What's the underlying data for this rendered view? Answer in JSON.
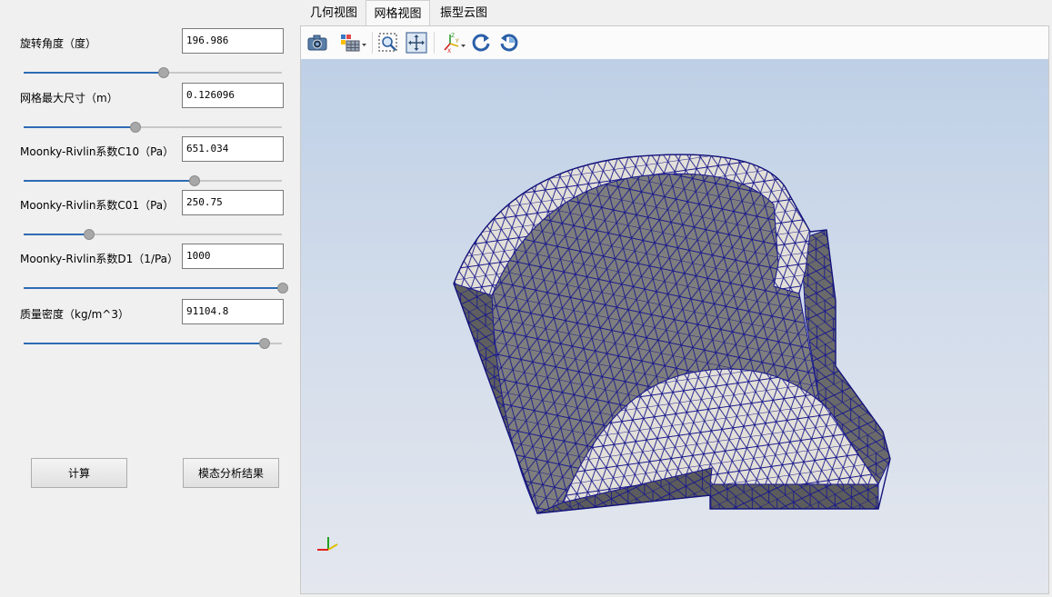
{
  "params": [
    {
      "label": "旋转角度（度）",
      "value": "196.986",
      "slider": 0.54
    },
    {
      "label": "网格最大尺寸（m）",
      "value": "0.126096",
      "slider": 0.43
    },
    {
      "label": "Moonky-Rivlin系数C10（Pa）",
      "value": "651.034",
      "slider": 0.66
    },
    {
      "label": "Moonky-Rivlin系数C01（Pa）",
      "value": "250.75",
      "slider": 0.25
    },
    {
      "label": "Moonky-Rivlin系数D1（1/Pa）",
      "value": "1000",
      "slider": 1.0
    },
    {
      "label": "质量密度（kg/m^3）",
      "value": "91104.8",
      "slider": 0.93
    }
  ],
  "buttons": {
    "compute": "计算",
    "results": "模态分析结果"
  },
  "tabs": [
    "几何视图",
    "网格视图",
    "振型云图"
  ],
  "active_tab": 1,
  "toolbar_icons": [
    "camera-icon",
    "display-mode-icon",
    "zoom-box-icon",
    "fit-view-icon",
    "axes-orientation-icon",
    "rotate-cw-icon",
    "rotate-ccw-icon"
  ],
  "viewport": {
    "bg_top": "#bed0e6",
    "bg_bottom": "#e4e7ee",
    "mesh_edge_color": "#1a1a8c",
    "face_light": "#e3e0d9",
    "face_mid": "#8a8a8a",
    "face_dark": "#5f5f5f"
  },
  "axes": {
    "x": "X",
    "y": "Y",
    "z": "Z",
    "x_color": "#e02020",
    "y_color": "#e0c000",
    "z_color": "#20a020"
  }
}
